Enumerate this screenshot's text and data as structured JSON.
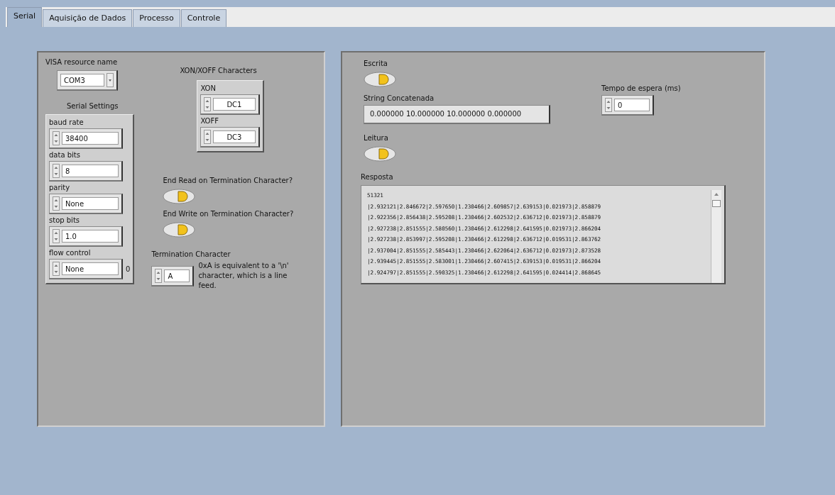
{
  "tabs": [
    {
      "label": "Serial",
      "selected": true
    },
    {
      "label": "Aquisição de Dados",
      "selected": false
    },
    {
      "label": "Processo",
      "selected": false
    },
    {
      "label": "Controle",
      "selected": false
    }
  ],
  "left_panel": {
    "visa": {
      "label": "VISA resource name",
      "value": "COM3"
    },
    "serial_settings": {
      "title": "Serial Settings",
      "fields": [
        {
          "label": "baud rate",
          "value": "38400"
        },
        {
          "label": "data bits",
          "value": "8"
        },
        {
          "label": "parity",
          "value": "None"
        },
        {
          "label": "stop bits",
          "value": "1.0"
        },
        {
          "label": "flow control",
          "value": "None",
          "suffix": "0"
        }
      ]
    },
    "xon_xoff": {
      "title": "XON/XOFF Characters",
      "fields": [
        {
          "label": "XON",
          "value": "DC1"
        },
        {
          "label": "XOFF",
          "value": "DC3"
        }
      ]
    },
    "switches": [
      {
        "label": "End Read on Termination Character?",
        "on": true
      },
      {
        "label": "End Write on Termination Character?",
        "on": true
      }
    ],
    "termination": {
      "label": "Termination Character",
      "value": "A",
      "note": "0xA is equivalent to a '\\n' character, which is a line feed."
    }
  },
  "right_panel": {
    "escrita": {
      "label": "Escrita",
      "on": true
    },
    "string": {
      "label": "String Concatenada",
      "value": "0.000000 10.000000 10.000000 0.000000"
    },
    "timeout": {
      "label": "Tempo de espera (ms)",
      "value": "0"
    },
    "leitura": {
      "label": "Leitura",
      "on": true
    },
    "resposta": {
      "label": "Resposta",
      "lines": [
        "51321",
        "|2.932121|2.846672|2.597650|1.230466|2.609857|2.639153|0.021973|2.858879",
        "|2.922356|2.856438|2.595208|1.230466|2.602532|2.636712|0.021973|2.858879",
        "|2.927238|2.851555|2.580560|1.230466|2.612298|2.641595|0.021973|2.866204",
        "|2.927238|2.853997|2.595208|1.230466|2.612298|2.636712|0.019531|2.863762",
        "|2.937004|2.851555|2.585443|1.230466|2.622064|2.636712|0.021973|2.873528",
        "|2.939445|2.851555|2.583001|1.230466|2.607415|2.639153|0.019531|2.866204",
        "|2.924797|2.851555|2.590325|1.230466|2.612298|2.641595|0.024414|2.868645"
      ]
    }
  }
}
